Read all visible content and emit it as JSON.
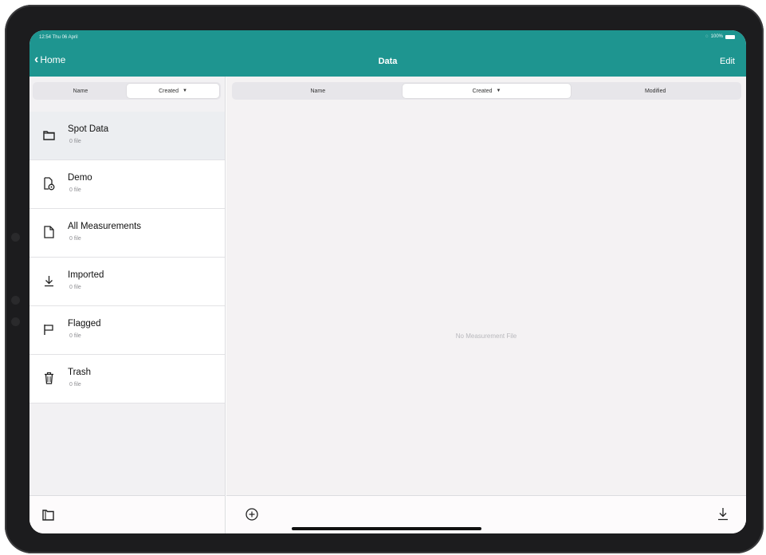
{
  "status_bar": {
    "time": "12:54 Thu 06 April",
    "battery": "100%"
  },
  "nav": {
    "back_label": "Home",
    "title": "Data",
    "edit_label": "Edit"
  },
  "sidebar": {
    "sort": {
      "options": [
        "Name",
        "Created"
      ],
      "selected": "Created"
    },
    "items": [
      {
        "title": "Spot Data",
        "subtitle": "0 file",
        "icon": "folder-icon",
        "selected": true
      },
      {
        "title": "Demo",
        "subtitle": "0 file",
        "icon": "demo-document-icon",
        "selected": false
      },
      {
        "title": "All Measurements",
        "subtitle": "0 file",
        "icon": "document-icon",
        "selected": false
      },
      {
        "title": "Imported",
        "subtitle": "0 file",
        "icon": "download-icon",
        "selected": false
      },
      {
        "title": "Flagged",
        "subtitle": "0 file",
        "icon": "flag-icon",
        "selected": false
      },
      {
        "title": "Trash",
        "subtitle": "0 file",
        "icon": "trash-icon",
        "selected": false
      }
    ],
    "bottom_icon": "new-folder-icon"
  },
  "main": {
    "sort": {
      "options": [
        "Name",
        "Created",
        "Modified"
      ],
      "selected": "Created"
    },
    "empty_text": "No Measurement File",
    "bottom_left_icon": "add-circle-icon",
    "bottom_right_icon": "download-icon"
  },
  "colors": {
    "accent": "#1e9590",
    "selected_row": "#eceef1",
    "background": "#f4f2f3"
  }
}
